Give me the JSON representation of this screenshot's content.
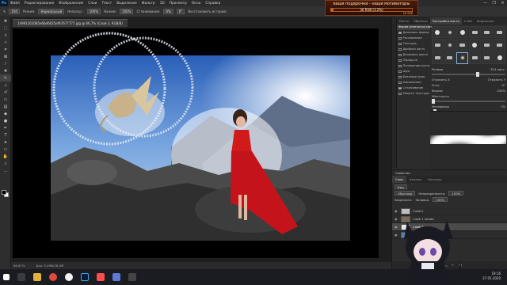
{
  "menu": {
    "app_logo": "Ps",
    "items": [
      "Файл",
      "Редактирование",
      "Изображение",
      "Слои",
      "Текст",
      "Выделение",
      "Фильтр",
      "3D",
      "Просмотр",
      "Окно",
      "Справка"
    ]
  },
  "banner": {
    "title": "ваши подарочки - наши мотиваторы",
    "progress_text": "30 RUB (3.2%)",
    "progress_fraction": 0.032,
    "count": "10 000"
  },
  "window_controls": [
    "—",
    "❐",
    "✕"
  ],
  "options_bar": {
    "brush_size": "100",
    "mode_label": "Режим:",
    "mode_value": "Нормальный",
    "opacity_label": "Непрозр.:",
    "opacity_value": "100%",
    "flow_label": "Нажим:",
    "flow_value": "100%",
    "smoothing_label": "Сглаживание:",
    "smoothing_value": "0%",
    "angle_value": "0°",
    "history_label": "Восстановить историю"
  },
  "toolbar": {
    "tools": [
      "move",
      "marquee",
      "lasso",
      "quick-select",
      "crop",
      "frame",
      "eyedropper",
      "healing",
      "brush",
      "clone-stamp",
      "history-brush",
      "eraser",
      "gradient",
      "blur",
      "dodge",
      "pen",
      "type",
      "path-select",
      "rectangle",
      "hand",
      "zoom",
      "more"
    ]
  },
  "document": {
    "tab_title": "14991262085e6bd6025ef67677777.jpg @ 66,7% (Слой 3, RGB/8)",
    "status_zoom": "66,67%",
    "status_doc": "Док: 5,49M/28,0M"
  },
  "panels": {
    "tabs": [
      "Кисти",
      "Образцы",
      "Настройки кисти",
      "Слой",
      "Коррекция",
      "Кисть"
    ],
    "active_tab": "Настройки кисти",
    "brush_header": "Форма отпечатка кисти",
    "brush_settings": [
      {
        "label": "Форма отпечатка кисти",
        "checked": false,
        "selected": true
      },
      {
        "label": "Динамика формы",
        "checked": true,
        "selected": false
      },
      {
        "label": "Рассеивание",
        "checked": false,
        "selected": false
      },
      {
        "label": "Текстура",
        "checked": false,
        "selected": false
      },
      {
        "label": "Двойная кисть",
        "checked": false,
        "selected": false
      },
      {
        "label": "Динамика цвета",
        "checked": false,
        "selected": false
      },
      {
        "label": "Передача",
        "checked": false,
        "selected": false
      },
      {
        "label": "Положение кисти",
        "checked": false,
        "selected": false
      },
      {
        "label": "Шум",
        "checked": false,
        "selected": false
      },
      {
        "label": "Влажные края",
        "checked": false,
        "selected": false
      },
      {
        "label": "Накопление",
        "checked": false,
        "selected": false
      },
      {
        "label": "Сглаживание",
        "checked": true,
        "selected": false
      },
      {
        "label": "Защита текстуры",
        "checked": false,
        "selected": false
      }
    ],
    "brush_controls": {
      "size_label": "Размер",
      "size_value": "354 пикс.",
      "flip_x": "Отразить X",
      "flip_y": "Отразить Y",
      "angle_label": "Угол:",
      "angle_value": "0°",
      "roundness_label": "Форма:",
      "roundness_value": "100%",
      "hardness_label": "Жесткость",
      "spacing_label": "Интервалы",
      "spacing_value": "1%"
    }
  },
  "properties": {
    "title": "Свойства"
  },
  "layers_panel": {
    "tabs": [
      "Слои",
      "Каналы",
      "Контуры"
    ],
    "active_tab": "Слои",
    "kind_label": "Вид",
    "blend_mode": "Обычные",
    "opacity_label": "Непрозрачность:",
    "opacity_value": "100%",
    "fill_label": "Заливка:",
    "fill_value": "100%",
    "lock_label": "Закрепить:",
    "layers": [
      {
        "name": "Слой 2",
        "visible": true,
        "selected": false
      },
      {
        "name": "Слой 1 копия",
        "visible": true,
        "selected": false
      },
      {
        "name": "Слой 3",
        "visible": true,
        "selected": true
      },
      {
        "name": "Фон",
        "visible": true,
        "selected": false
      }
    ]
  },
  "taskbar": {
    "time": "19:16",
    "date": "27.01.2020"
  },
  "colors": {
    "accent_ps": "#31a8ff",
    "dress_red": "#d11a1a",
    "sky_blue": "#5a8fd6"
  }
}
